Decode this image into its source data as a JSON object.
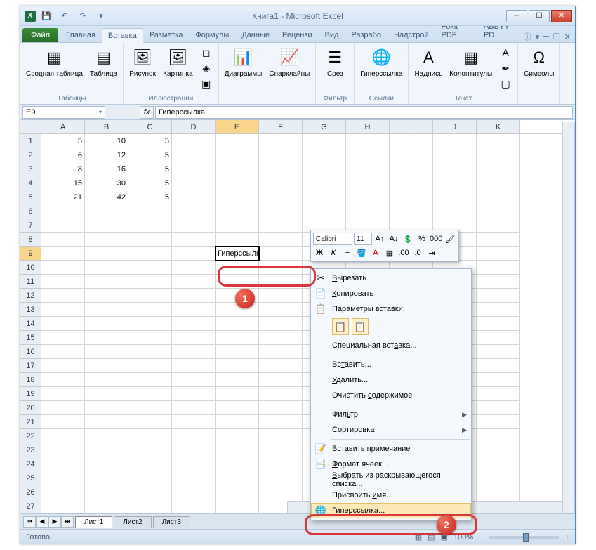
{
  "window": {
    "title": "Книга1 - Microsoft Excel"
  },
  "tabs": {
    "file": "Файл",
    "list": [
      "Главная",
      "Вставка",
      "Разметка",
      "Формулы",
      "Данные",
      "Рецензи",
      "Вид",
      "Разрабо",
      "Надстрой",
      "Foxit PDF",
      "ABBYY PD"
    ],
    "active": 1
  },
  "ribbon": {
    "g_tables": {
      "label": "Таблицы",
      "pivot": "Сводная\nтаблица",
      "table": "Таблица"
    },
    "g_illus": {
      "label": "Иллюстрации",
      "pic": "Рисунок",
      "clip": "Картинка"
    },
    "g_charts": {
      "label": "",
      "charts": "Диаграммы",
      "spark": "Спарклайны"
    },
    "g_filter": {
      "label": "Фильтр",
      "slicer": "Срез"
    },
    "g_links": {
      "label": "Ссылки",
      "hyper": "Гиперссылка"
    },
    "g_text": {
      "label": "Текст",
      "textbox": "Надпись",
      "header": "Колонтитулы"
    },
    "g_sym": {
      "label": "",
      "sym": "Символы"
    }
  },
  "namebox": "E9",
  "formula": "Гиперссылка",
  "columns": [
    "A",
    "B",
    "C",
    "D",
    "E",
    "F",
    "G",
    "H",
    "I",
    "J",
    "K"
  ],
  "active_col": 4,
  "active_row": 9,
  "rows": 27,
  "cells": {
    "1": {
      "A": "5",
      "B": "10",
      "C": "5"
    },
    "2": {
      "A": "6",
      "B": "12",
      "C": "5"
    },
    "3": {
      "A": "8",
      "B": "16",
      "C": "5"
    },
    "4": {
      "A": "15",
      "B": "30",
      "C": "5"
    },
    "5": {
      "A": "21",
      "B": "42",
      "C": "5"
    },
    "9": {
      "E": "Гиперссылка"
    }
  },
  "mini": {
    "font": "Calibri",
    "size": "11"
  },
  "context": {
    "cut": "Вырезать",
    "copy": "Копировать",
    "paste_opts": "Параметры вставки:",
    "paste_special": "Специальная вставка...",
    "insert": "Вставить...",
    "delete": "Удалить...",
    "clear": "Очистить содержимое",
    "filter": "Фильтр",
    "sort": "Сортировка",
    "comment": "Вставить примечание",
    "format": "Формат ячеек...",
    "dropdown": "Выбрать из раскрывающегося списка...",
    "name": "Присвоить имя...",
    "hyperlink": "Гиперссылка..."
  },
  "sheets": [
    "Лист1",
    "Лист2",
    "Лист3"
  ],
  "status": {
    "ready": "Готово",
    "zoom": "100%"
  }
}
